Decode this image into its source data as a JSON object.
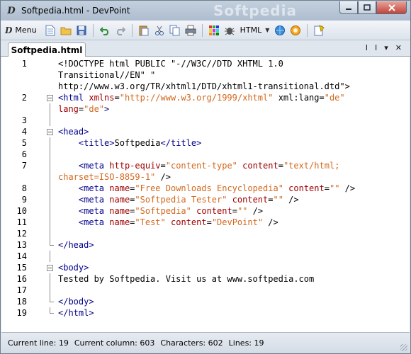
{
  "window": {
    "title": "Softpedia.html - DevPoint",
    "watermark": "Softpedia",
    "controls": {
      "minimize": "–",
      "maximize": "▢",
      "close": "✕"
    }
  },
  "toolbar": {
    "menu_label": "Menu",
    "language_label": "HTML",
    "icons": [
      "new-document-icon",
      "open-folder-icon",
      "save-icon",
      "undo-icon",
      "redo-icon",
      "paste-icon",
      "cut-icon",
      "copy-icon",
      "print-icon",
      "color-picker-icon",
      "settings-bug-icon",
      "language-select",
      "browser-preview-icon",
      "ie-preview-icon",
      "bookmark-icon"
    ]
  },
  "tabs": [
    {
      "label": "Softpedia.html",
      "active": true
    }
  ],
  "tab_tools": {
    "split_label": "I",
    "list_label": "I",
    "dropdown": "▾",
    "close": "✕"
  },
  "editor": {
    "lines": [
      {
        "num": "1",
        "fold": "",
        "segs": [
          [
            "t-text",
            "<!DOCTYPE html PUBLIC \"-//W3C//DTD XHTML 1.0"
          ]
        ]
      },
      {
        "num": "",
        "fold": "",
        "segs": [
          [
            "t-text",
            "Transitional//EN\" \""
          ]
        ]
      },
      {
        "num": "",
        "fold": "",
        "segs": [
          [
            "t-text",
            "http://www.w3.org/TR/xhtml1/DTD/xhtml1-transitional.dtd\">"
          ]
        ]
      },
      {
        "num": "2",
        "fold": "open",
        "segs": [
          [
            "t-tag",
            "<html "
          ],
          [
            "t-attr",
            "xmlns"
          ],
          [
            "t-text",
            "="
          ],
          [
            "t-str",
            "\"http://www.w3.org/1999/xhtml\""
          ],
          [
            "t-text",
            " xml:lang="
          ],
          [
            "t-str",
            "\"de\""
          ]
        ]
      },
      {
        "num": "",
        "fold": "line",
        "segs": [
          [
            "t-attr",
            "lang"
          ],
          [
            "t-text",
            "="
          ],
          [
            "t-str",
            "\"de\""
          ],
          [
            "t-tag",
            ">"
          ]
        ]
      },
      {
        "num": "3",
        "fold": "line",
        "segs": []
      },
      {
        "num": "4",
        "fold": "open",
        "segs": [
          [
            "t-tag",
            "<head>"
          ]
        ]
      },
      {
        "num": "5",
        "fold": "line",
        "segs": [
          [
            "t-text",
            "    "
          ],
          [
            "t-tag",
            "<title>"
          ],
          [
            "t-text",
            "Softpedia"
          ],
          [
            "t-tag",
            "</title>"
          ]
        ]
      },
      {
        "num": "6",
        "fold": "line",
        "segs": []
      },
      {
        "num": "7",
        "fold": "line",
        "segs": [
          [
            "t-text",
            "    "
          ],
          [
            "t-tag",
            "<meta "
          ],
          [
            "t-attr",
            "http-equiv"
          ],
          [
            "t-text",
            "="
          ],
          [
            "t-str",
            "\"content-type\""
          ],
          [
            "t-text",
            " "
          ],
          [
            "t-attr",
            "content"
          ],
          [
            "t-text",
            "="
          ],
          [
            "t-str",
            "\"text/html;"
          ]
        ]
      },
      {
        "num": "",
        "fold": "line",
        "segs": [
          [
            "t-str",
            "charset=ISO-8859-1\""
          ],
          [
            "t-text",
            " />"
          ]
        ]
      },
      {
        "num": "8",
        "fold": "line",
        "segs": [
          [
            "t-text",
            "    "
          ],
          [
            "t-tag",
            "<meta "
          ],
          [
            "t-attr",
            "name"
          ],
          [
            "t-text",
            "="
          ],
          [
            "t-str",
            "\"Free Downloads Encyclopedia\""
          ],
          [
            "t-text",
            " "
          ],
          [
            "t-attr",
            "content"
          ],
          [
            "t-text",
            "="
          ],
          [
            "t-str",
            "\"\""
          ],
          [
            "t-text",
            " />"
          ]
        ]
      },
      {
        "num": "9",
        "fold": "line",
        "segs": [
          [
            "t-text",
            "    "
          ],
          [
            "t-tag",
            "<meta "
          ],
          [
            "t-attr",
            "name"
          ],
          [
            "t-text",
            "="
          ],
          [
            "t-str",
            "\"Softpedia Tester\""
          ],
          [
            "t-text",
            " "
          ],
          [
            "t-attr",
            "content"
          ],
          [
            "t-text",
            "="
          ],
          [
            "t-str",
            "\"\""
          ],
          [
            "t-text",
            " />"
          ]
        ]
      },
      {
        "num": "10",
        "fold": "line",
        "segs": [
          [
            "t-text",
            "    "
          ],
          [
            "t-tag",
            "<meta "
          ],
          [
            "t-attr",
            "name"
          ],
          [
            "t-text",
            "="
          ],
          [
            "t-str",
            "\"Softpedia\""
          ],
          [
            "t-text",
            " "
          ],
          [
            "t-attr",
            "content"
          ],
          [
            "t-text",
            "="
          ],
          [
            "t-str",
            "\"\""
          ],
          [
            "t-text",
            " />"
          ]
        ]
      },
      {
        "num": "11",
        "fold": "line",
        "segs": [
          [
            "t-text",
            "    "
          ],
          [
            "t-tag",
            "<meta "
          ],
          [
            "t-attr",
            "name"
          ],
          [
            "t-text",
            "="
          ],
          [
            "t-str",
            "\"Test\""
          ],
          [
            "t-text",
            " "
          ],
          [
            "t-attr",
            "content"
          ],
          [
            "t-text",
            "="
          ],
          [
            "t-str",
            "\"DevPoint\""
          ],
          [
            "t-text",
            " />"
          ]
        ]
      },
      {
        "num": "12",
        "fold": "line",
        "segs": []
      },
      {
        "num": "13",
        "fold": "end",
        "segs": [
          [
            "t-tag",
            "</head>"
          ]
        ]
      },
      {
        "num": "14",
        "fold": "line",
        "segs": []
      },
      {
        "num": "15",
        "fold": "open",
        "segs": [
          [
            "t-tag",
            "<body>"
          ]
        ]
      },
      {
        "num": "16",
        "fold": "line",
        "segs": [
          [
            "t-text",
            "Tested by Softpedia. Visit us at www.softpedia.com"
          ]
        ]
      },
      {
        "num": "17",
        "fold": "line",
        "segs": []
      },
      {
        "num": "18",
        "fold": "end",
        "segs": [
          [
            "t-tag",
            "</body>"
          ]
        ]
      },
      {
        "num": "19",
        "fold": "end",
        "segs": [
          [
            "t-tag",
            "</html>"
          ]
        ]
      }
    ]
  },
  "status": {
    "current_line": "Current line: 19",
    "current_column": "Current column: 603",
    "characters": "Characters: 602",
    "lines": "Lines: 19"
  }
}
